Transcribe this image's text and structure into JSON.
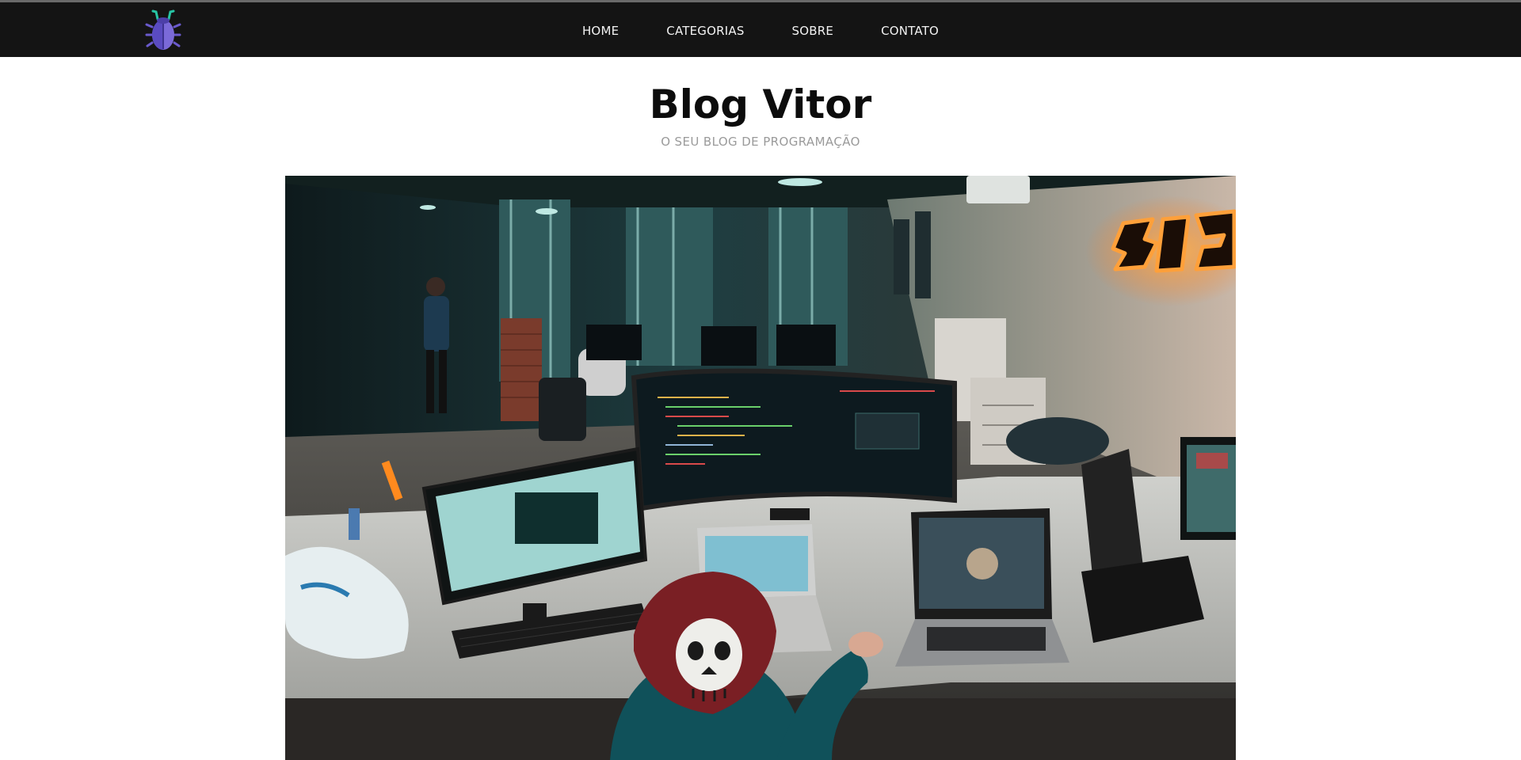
{
  "nav": {
    "logo_icon": "bug-icon",
    "links": [
      "HOME",
      "CATEGORIAS",
      "SOBRE",
      "CONTATO"
    ]
  },
  "header": {
    "title": "Blog Vitor",
    "subtitle": "O SEU BLOG DE PROGRAMAÇÃO"
  },
  "hero": {
    "image": "hero-image-developer-workspace"
  },
  "colors": {
    "navbar": "#141414",
    "logo_body": "#6a5acd",
    "logo_antenna": "#27c4a5",
    "title": "#0c0c0c",
    "subtitle": "#9a9a9a",
    "sign_glow": "#ff8a1e"
  }
}
